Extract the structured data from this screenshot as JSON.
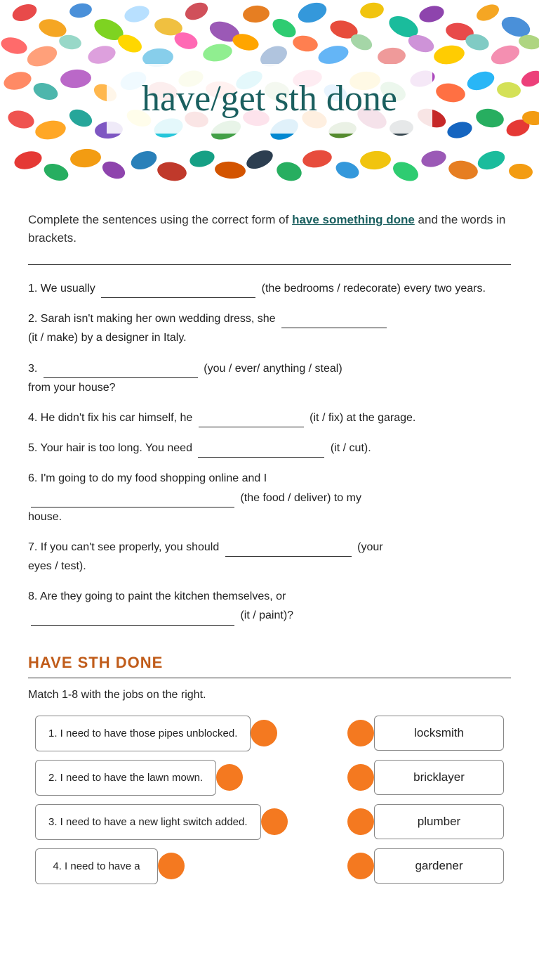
{
  "header": {
    "title": "have/get sth done"
  },
  "instruction": {
    "text_before": "Complete the sentences using the correct form of ",
    "bold_text": "have something done",
    "text_after": " and the words in brackets."
  },
  "sentences": [
    {
      "number": "1.",
      "before": "We usually",
      "blank_size": "normal",
      "after": "(the bedrooms / redecorate) every two years."
    },
    {
      "number": "2.",
      "before": "Sarah isn't making her own wedding dress, she",
      "blank_size": "short",
      "after": "(it / make) by a designer in Italy."
    },
    {
      "number": "3.",
      "before": "",
      "blank_size": "normal",
      "after": "(you / ever/ anything / steal) from your house?"
    },
    {
      "number": "4.",
      "before": "He didn't fix his car himself, he",
      "blank_size": "short",
      "after": "(it / fix) at the garage."
    },
    {
      "number": "5.",
      "before": "Your hair is too long. You need",
      "blank_size": "medium",
      "after": "(it / cut)."
    },
    {
      "number": "6.",
      "before": "I'm going to do my food shopping online and I",
      "blank_size": "normal",
      "after": "(the food / deliver) to my house.",
      "multiline": true
    },
    {
      "number": "7.",
      "before": "If you can't see properly, you should",
      "blank_size": "medium",
      "after": "(your eyes / test)."
    },
    {
      "number": "8.",
      "before": "Are they going to paint the kitchen themselves, or",
      "blank_size": "normal",
      "after": "(it / paint)?",
      "multiline": true
    }
  ],
  "section2": {
    "heading": "HAVE STH DONE",
    "instruction": "Match 1-8 with the jobs on the right.",
    "items_left": [
      "1. I need to have those pipes unblocked.",
      "2. I need to have the lawn mown.",
      "3. I need to have a new light switch added.",
      "4. I need to have a"
    ],
    "items_right": [
      "locksmith",
      "bricklayer",
      "plumber",
      "gardener"
    ]
  }
}
